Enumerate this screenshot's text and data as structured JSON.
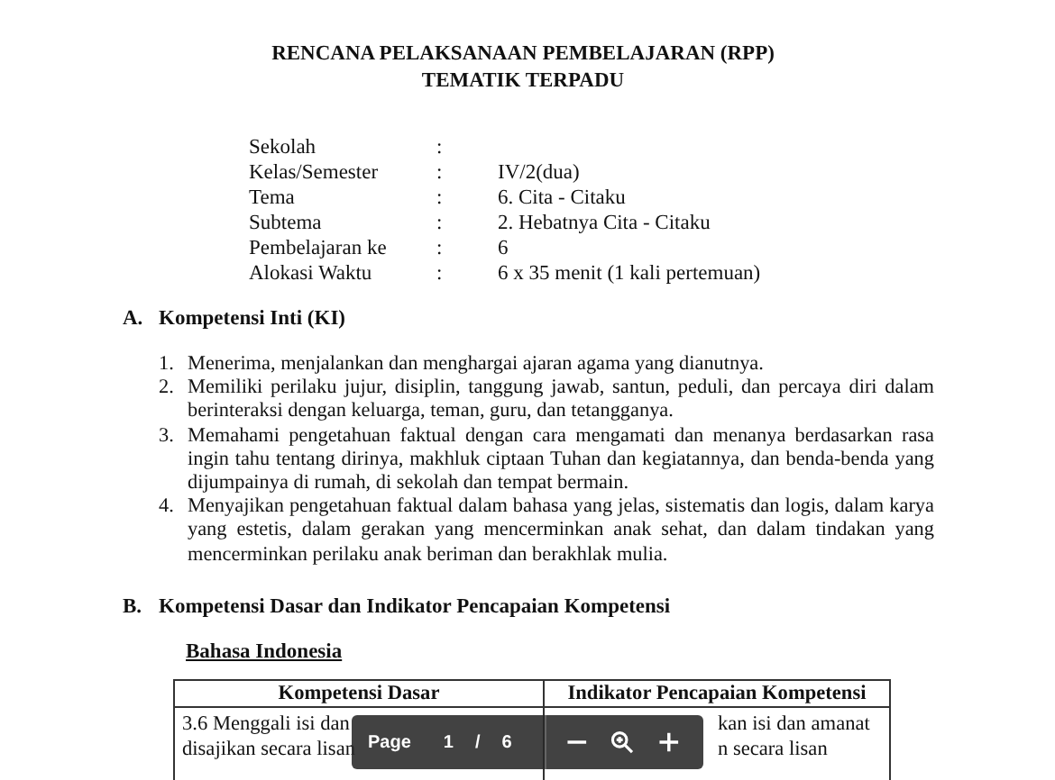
{
  "document": {
    "title_lines": [
      "RENCANA PELAKSANAAN PEMBELAJARAN (RPP)",
      "TEMATIK TERPADU"
    ],
    "info": [
      {
        "label": "Sekolah"
      },
      {
        "label": "Kelas/Semester",
        "value": "IV/2(dua)"
      },
      {
        "label": "Tema",
        "value": "6. Cita - Citaku"
      },
      {
        "label": "Subtema",
        "value": "2.  Hebatnya Cita - Citaku"
      },
      {
        "label": "Pembelajaran ke",
        "value": "6"
      },
      {
        "label": "Alokasi Waktu",
        "value": "6 x 35 menit (1 kali pertemuan)"
      }
    ],
    "info_separator": ":",
    "section_a": {
      "letter": "A.",
      "heading": "Kompetensi Inti (KI)"
    },
    "ki_items": [
      {
        "number": "1.",
        "text": "Menerima, menjalankan dan menghargai ajaran agama yang dianutnya."
      },
      {
        "number": "2.",
        "text": "Memiliki perilaku jujur, disiplin, tanggung jawab, santun, peduli, dan percaya diri dalam berinteraksi dengan keluarga, teman, guru, dan tetangganya."
      },
      {
        "number": "3.",
        "text": "Memahami pengetahuan faktual dengan cara mengamati dan menanya berdasarkan rasa ingin tahu tentang dirinya, makhluk ciptaan Tuhan dan kegiatannya, dan benda-benda yang dijumpainya di rumah, di sekolah dan tempat bermain."
      },
      {
        "number": "4.",
        "text": "Menyajikan pengetahuan faktual dalam  bahasa yang jelas, sistematis dan logis, dalam karya yang estetis, dalam gerakan yang mencerminkan anak sehat, dan dalam tindakan yang mencerminkan perilaku anak beriman dan berakhlak mulia."
      }
    ],
    "section_b": {
      "letter": "B.",
      "heading": "Kompetensi Dasar dan Indikator Pencapaian Kompetensi"
    },
    "subject": "Bahasa Indonesia",
    "table": {
      "columns": [
        "Kompetensi Dasar",
        "Indikator Pencapaian Kompetensi"
      ],
      "rows": [
        [
          [
            "3.6 Menggali isi dan",
            "disajikan secara lisan"
          ],
          [
            "kan isi dan amanat",
            "n secara lisan"
          ]
        ]
      ]
    }
  },
  "toolbar": {
    "page_label": "Page",
    "current_page": "1",
    "separator": "/",
    "total_pages": "6"
  }
}
